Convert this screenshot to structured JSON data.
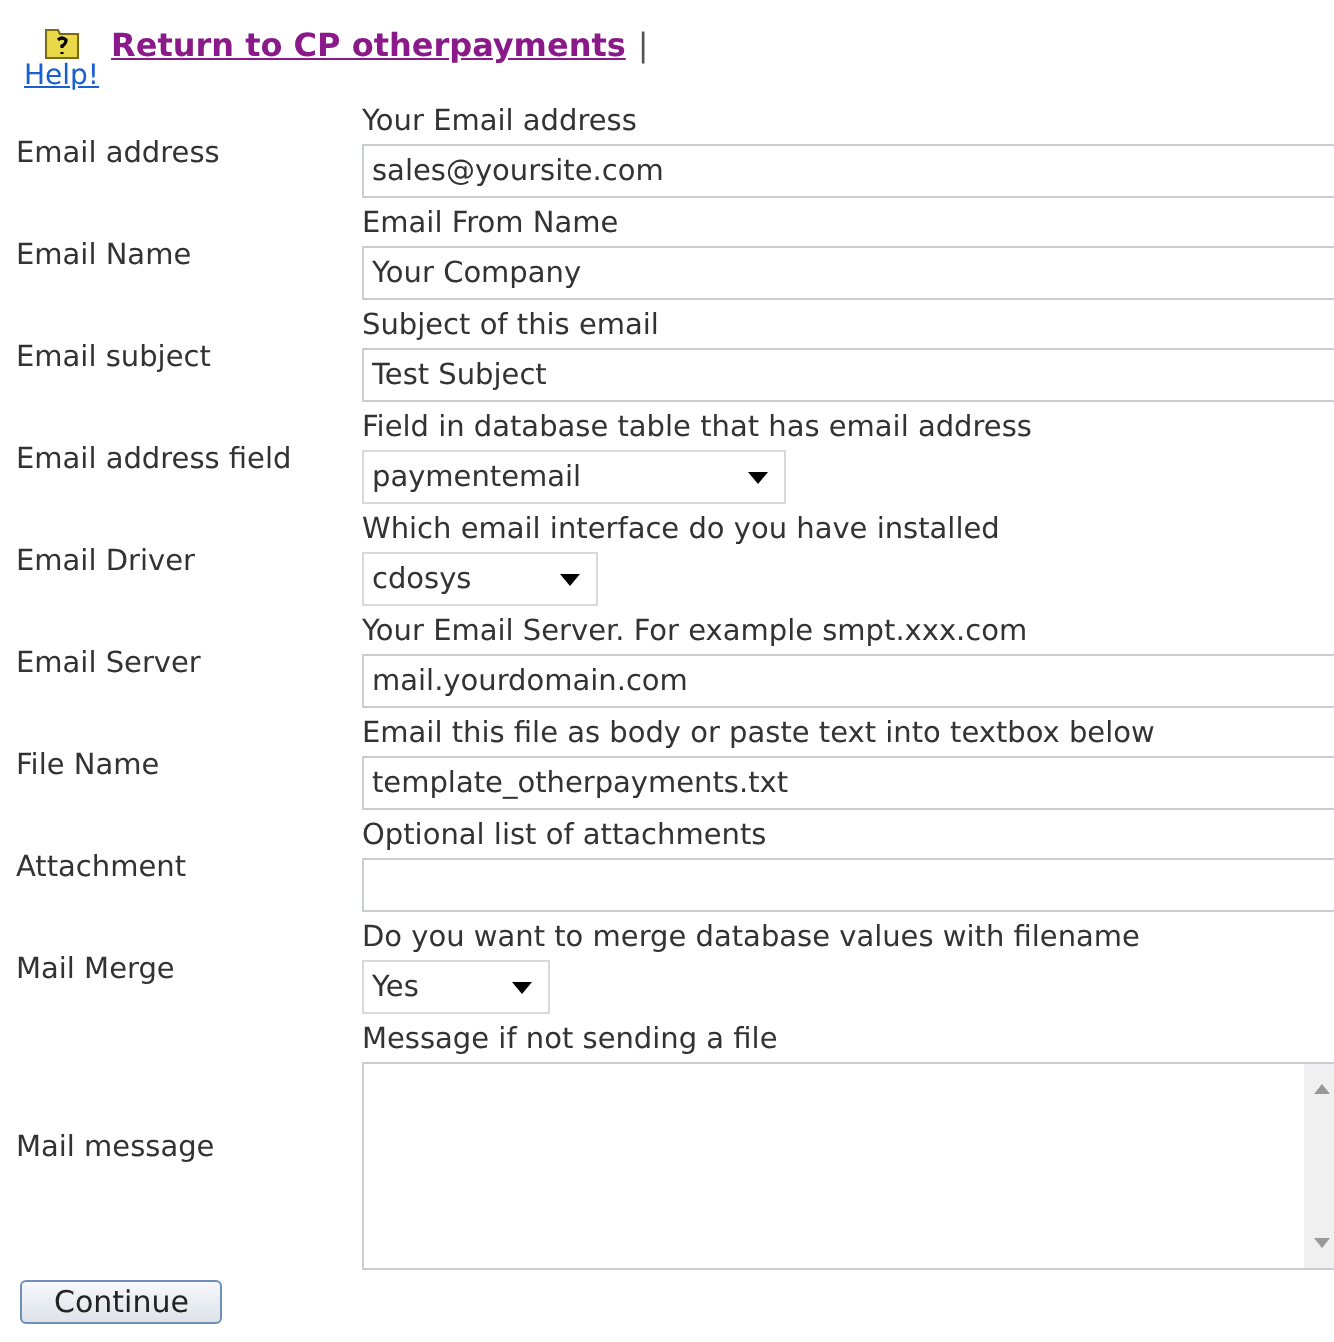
{
  "header": {
    "help_link": "Help!",
    "return_link": "Return to CP  otherpayments",
    "separator": "|"
  },
  "fields": [
    {
      "label": "Email address",
      "hint": "Your Email address",
      "kind": "text",
      "value": "sales@yoursite.com"
    },
    {
      "label": "Email Name",
      "hint": "Email From Name",
      "kind": "text",
      "value": "Your Company"
    },
    {
      "label": "Email subject",
      "hint": "Subject of this email",
      "kind": "text",
      "value": "Test Subject"
    },
    {
      "label": "Email address field",
      "hint": "Field in database table that has email address",
      "kind": "select",
      "value": "paymentemail"
    },
    {
      "label": "Email Driver",
      "hint": "Which email interface do you have installed",
      "kind": "select",
      "value": "cdosys"
    },
    {
      "label": "Email Server",
      "hint": "Your Email Server. For example smpt.xxx.com",
      "kind": "text",
      "value": "mail.yourdomain.com"
    },
    {
      "label": "File Name",
      "hint": "Email this file as body or paste text into textbox below",
      "kind": "text",
      "value": "template_otherpayments.txt"
    },
    {
      "label": "Attachment",
      "hint": "Optional list of attachments",
      "kind": "text"
    },
    {
      "label": "Mail Merge",
      "hint": "Do you want to merge database values with filename",
      "kind": "select",
      "value": "Yes"
    },
    {
      "label": "Mail message",
      "hint": "Message if not sending a file",
      "kind": "textarea"
    }
  ],
  "submit_button": "Continue"
}
